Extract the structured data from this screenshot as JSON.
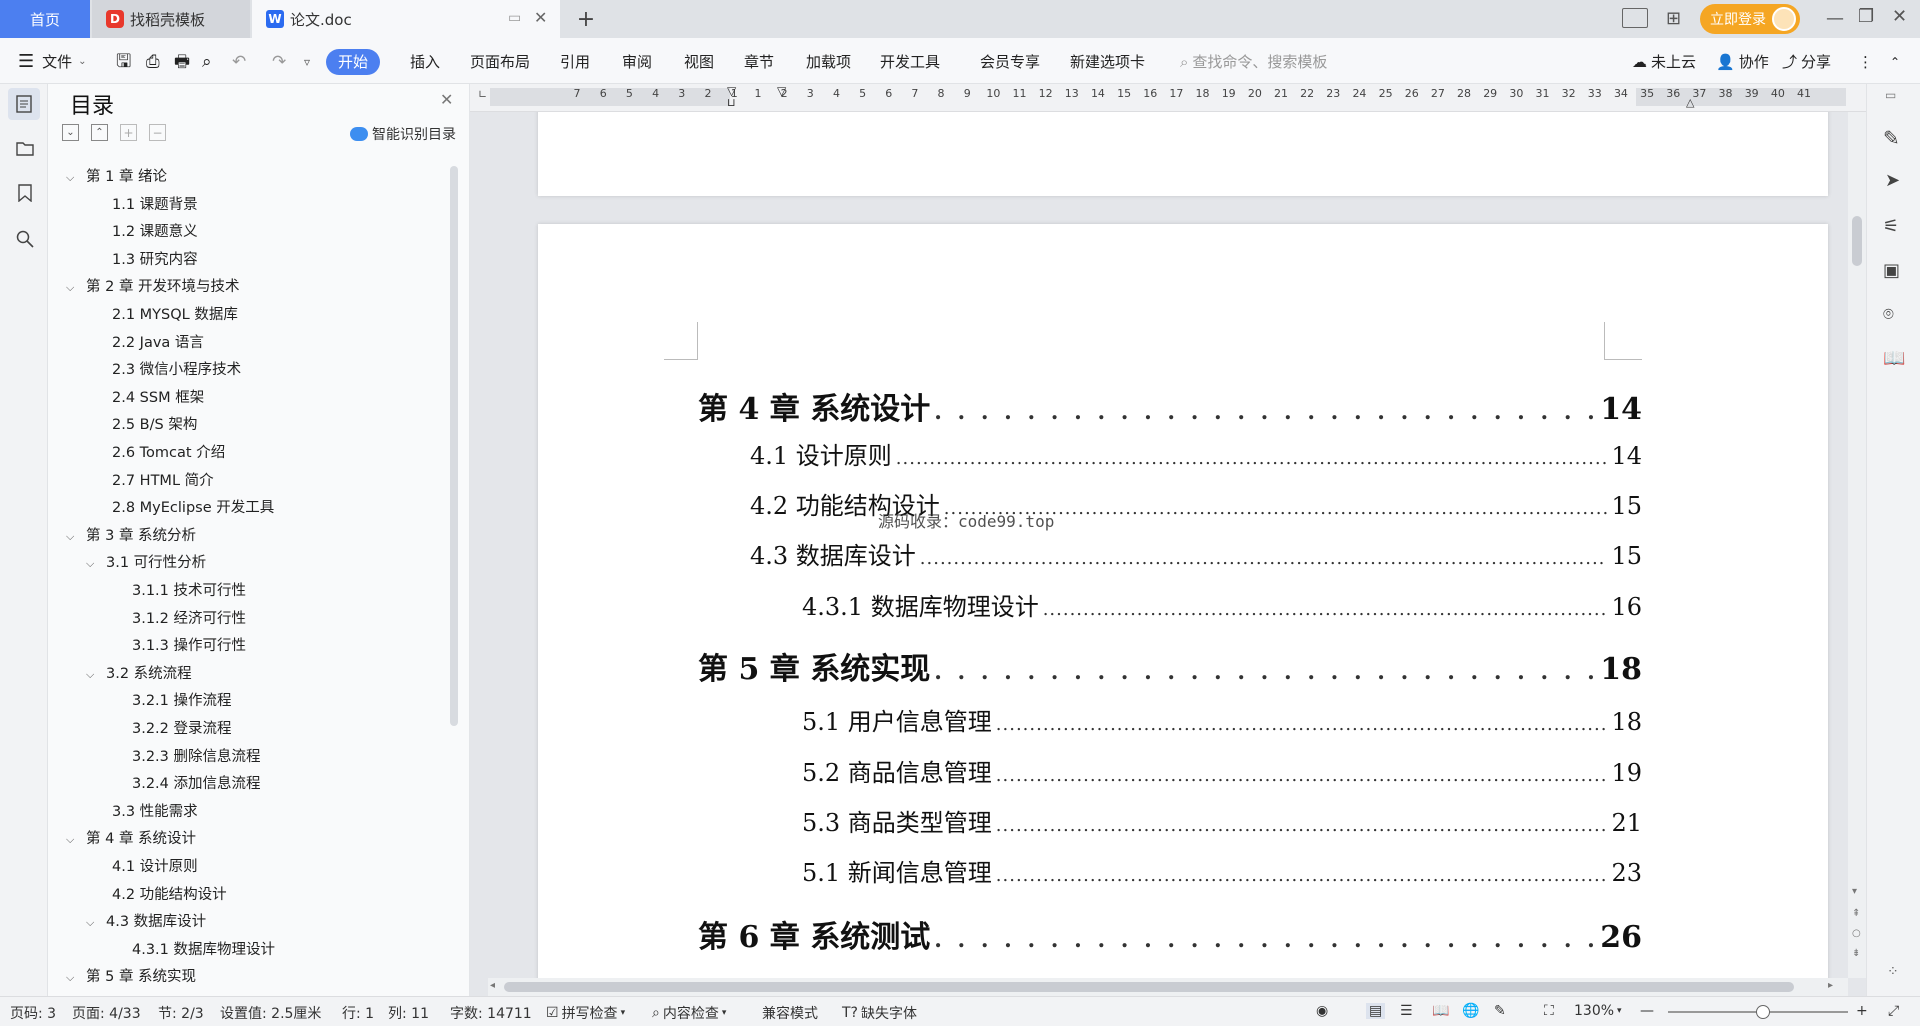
{
  "tabs": {
    "home": "首页",
    "templates": "找稻壳模板",
    "document": "论文.doc"
  },
  "titlebar": {
    "login": "立即登录"
  },
  "ribbon": {
    "file": "文件",
    "items": [
      "开始",
      "插入",
      "页面布局",
      "引用",
      "审阅",
      "视图",
      "章节",
      "加载项",
      "开发工具",
      "会员专享",
      "新建选项卡"
    ],
    "search_placeholder": "查找命令、搜索模板",
    "cloud": "未上云",
    "collab": "协作",
    "share": "分享"
  },
  "toc_panel": {
    "title": "目录",
    "smart": "智能识别目录",
    "items": [
      {
        "label": "第 1 章  绪论",
        "level": 0,
        "expand": true
      },
      {
        "label": "1.1  课题背景",
        "level": 1
      },
      {
        "label": "1.2  课题意义",
        "level": 1
      },
      {
        "label": "1.3  研究内容",
        "level": 1
      },
      {
        "label": "第 2 章  开发环境与技术",
        "level": 0,
        "expand": true
      },
      {
        "label": "2.1  MYSQL 数据库",
        "level": 1
      },
      {
        "label": "2.2  Java 语言",
        "level": 1
      },
      {
        "label": "2.3  微信小程序技术",
        "level": 1
      },
      {
        "label": "2.4  SSM 框架",
        "level": 1
      },
      {
        "label": "2.5  B/S 架构",
        "level": 1
      },
      {
        "label": "2.6  Tomcat  介绍",
        "level": 1
      },
      {
        "label": "2.7  HTML 简介",
        "level": 1
      },
      {
        "label": "2.8  MyEclipse 开发工具",
        "level": 1
      },
      {
        "label": "第 3 章  系统分析",
        "level": 0,
        "expand": true
      },
      {
        "label": "3.1  可行性分析",
        "level": 1,
        "expand": true
      },
      {
        "label": "3.1.1  技术可行性",
        "level": 2
      },
      {
        "label": "3.1.2  经济可行性",
        "level": 2
      },
      {
        "label": "3.1.3  操作可行性",
        "level": 2
      },
      {
        "label": "3.2  系统流程",
        "level": 1,
        "expand": true
      },
      {
        "label": "3.2.1  操作流程",
        "level": 2
      },
      {
        "label": "3.2.2  登录流程",
        "level": 2
      },
      {
        "label": "3.2.3  删除信息流程",
        "level": 2
      },
      {
        "label": "3.2.4  添加信息流程",
        "level": 2
      },
      {
        "label": "3.3  性能需求",
        "level": 1
      },
      {
        "label": "第 4 章  系统设计",
        "level": 0,
        "expand": true
      },
      {
        "label": "4.1  设计原则",
        "level": 1
      },
      {
        "label": "4.2  功能结构设计",
        "level": 1
      },
      {
        "label": "4.3  数据库设计",
        "level": 1,
        "expand": true
      },
      {
        "label": "4.3.1  数据库物理设计",
        "level": 2
      },
      {
        "label": "第 5 章  系统实现",
        "level": 0,
        "expand": true
      }
    ]
  },
  "ruler": {
    "left_ticks": [
      "7",
      "6",
      "5",
      "4",
      "3",
      "2",
      "1"
    ],
    "right_ticks": [
      "1",
      "2",
      "3",
      "4",
      "5",
      "6",
      "7",
      "8",
      "9",
      "10",
      "11",
      "12",
      "13",
      "14",
      "15",
      "16",
      "17",
      "18",
      "19",
      "20",
      "21",
      "22",
      "23",
      "24",
      "25",
      "26",
      "27",
      "28",
      "29",
      "30",
      "31",
      "32",
      "33",
      "34",
      "35",
      "36",
      "37",
      "38",
      "39",
      "40",
      "41"
    ]
  },
  "document": {
    "watermark": "源码收录：code99.top",
    "lines": [
      {
        "text": "第 4 章  系统设计",
        "page": "14",
        "kind": "chapter",
        "indent": 0
      },
      {
        "text": "4.1  设计原则",
        "page": "14",
        "kind": "section",
        "indent": 1
      },
      {
        "text": "4.2  功能结构设计",
        "page": "15",
        "kind": "section",
        "indent": 1
      },
      {
        "text": "4.3  数据库设计",
        "page": "15",
        "kind": "section",
        "indent": 1
      },
      {
        "text": "4.3.1  数据库物理设计",
        "page": "16",
        "kind": "section",
        "indent": 2
      },
      {
        "text": "第 5 章  系统实现",
        "page": "18",
        "kind": "chapter",
        "indent": 0
      },
      {
        "text": "5.1 用户信息管理",
        "page": "18",
        "kind": "section",
        "indent": 2
      },
      {
        "text": "5.2  商品信息管理",
        "page": "19",
        "kind": "section",
        "indent": 2
      },
      {
        "text": "5.3 商品类型管理",
        "page": "21",
        "kind": "section",
        "indent": 2
      },
      {
        "text": "5.1 新闻信息管理",
        "page": "23",
        "kind": "section",
        "indent": 2
      },
      {
        "text": "第 6 章  系统测试",
        "page": "26",
        "kind": "chapter",
        "indent": 0
      }
    ]
  },
  "status": {
    "page_no": "页码: 3",
    "pages": "页面: 4/33",
    "section": "节: 2/3",
    "setting": "设置值: 2.5厘米",
    "line": "行: 1",
    "col": "列: 11",
    "words": "字数: 14711",
    "spell": "拼写检查",
    "content_check": "内容检查",
    "compat": "兼容模式",
    "missing_font": "缺失字体",
    "zoom": "130%"
  },
  "colors": {
    "accent": "#4c7ff0",
    "login_bg": "#f5a623"
  }
}
